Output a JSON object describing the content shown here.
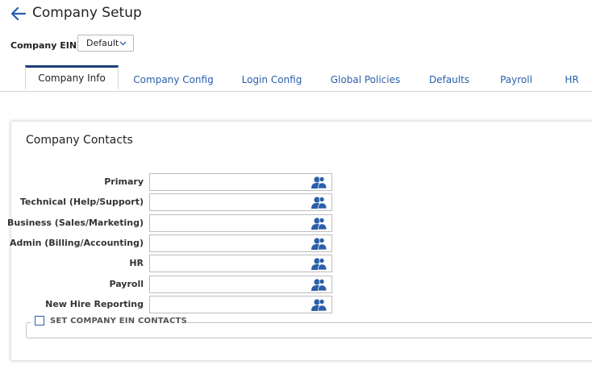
{
  "header": {
    "title": "Company Setup",
    "back_icon": "arrow-left-icon"
  },
  "company_ein": {
    "label": "Company EIN",
    "selected": "Default"
  },
  "tabs": [
    {
      "label": "Company Info",
      "active": true
    },
    {
      "label": "Company Config",
      "active": false
    },
    {
      "label": "Login Config",
      "active": false
    },
    {
      "label": "Global Policies",
      "active": false
    },
    {
      "label": "Defaults",
      "active": false
    },
    {
      "label": "Payroll",
      "active": false
    },
    {
      "label": "HR",
      "active": false
    }
  ],
  "panel": {
    "title": "Company Contacts",
    "contacts": [
      {
        "label": "Primary",
        "value": ""
      },
      {
        "label": "Technical (Help/Support)",
        "value": ""
      },
      {
        "label": "Business (Sales/Marketing)",
        "value": ""
      },
      {
        "label": "Admin (Billing/Accounting)",
        "value": ""
      },
      {
        "label": "HR",
        "value": ""
      },
      {
        "label": "Payroll",
        "value": ""
      },
      {
        "label": "New Hire Reporting",
        "value": ""
      }
    ],
    "ein_contacts_checkbox": {
      "label": "SET COMPANY EIN CONTACTS",
      "checked": false
    }
  },
  "colors": {
    "accent": "#2a5faa",
    "tab_active_border": "#1d3f73"
  }
}
